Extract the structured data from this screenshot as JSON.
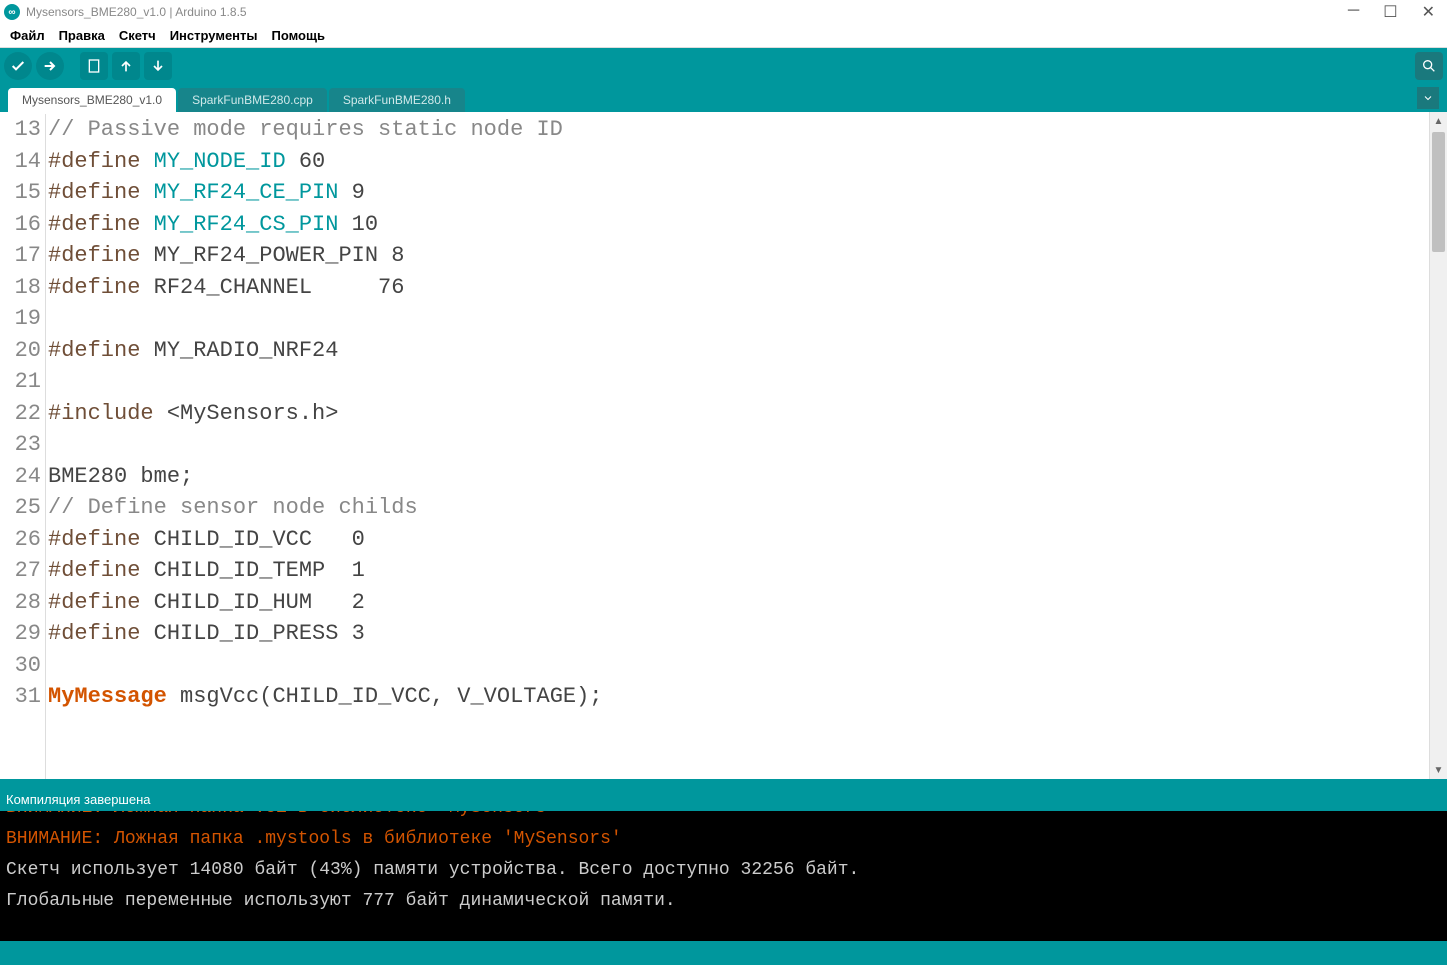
{
  "window": {
    "title": "Mysensors_BME280_v1.0 | Arduino 1.8.5"
  },
  "menu": {
    "file": "Файл",
    "edit": "Правка",
    "sketch": "Скетч",
    "tools": "Инструменты",
    "help": "Помощь"
  },
  "tabs": [
    {
      "label": "Mysensors_BME280_v1.0",
      "active": true
    },
    {
      "label": "SparkFunBME280.cpp",
      "active": false
    },
    {
      "label": "SparkFunBME280.h",
      "active": false
    }
  ],
  "editor": {
    "first_line": 13,
    "lines": [
      {
        "n": 13,
        "segs": [
          {
            "t": "// Passive mode requires static node ID",
            "c": "c-comment"
          }
        ]
      },
      {
        "n": 14,
        "segs": [
          {
            "t": "#define",
            "c": "c-preproc"
          },
          {
            "t": " ",
            "c": ""
          },
          {
            "t": "MY_NODE_ID",
            "c": "c-keyword"
          },
          {
            "t": " 60",
            "c": "c-text"
          }
        ]
      },
      {
        "n": 15,
        "segs": [
          {
            "t": "#define",
            "c": "c-preproc"
          },
          {
            "t": " ",
            "c": ""
          },
          {
            "t": "MY_RF24_CE_PIN",
            "c": "c-keyword"
          },
          {
            "t": " 9",
            "c": "c-text"
          }
        ]
      },
      {
        "n": 16,
        "segs": [
          {
            "t": "#define",
            "c": "c-preproc"
          },
          {
            "t": " ",
            "c": ""
          },
          {
            "t": "MY_RF24_CS_PIN",
            "c": "c-keyword"
          },
          {
            "t": " 10",
            "c": "c-text"
          }
        ]
      },
      {
        "n": 17,
        "segs": [
          {
            "t": "#define",
            "c": "c-preproc"
          },
          {
            "t": " MY_RF24_POWER_PIN 8",
            "c": "c-text"
          }
        ]
      },
      {
        "n": 18,
        "segs": [
          {
            "t": "#define",
            "c": "c-preproc"
          },
          {
            "t": " RF24_CHANNEL     76",
            "c": "c-text"
          }
        ]
      },
      {
        "n": 19,
        "segs": []
      },
      {
        "n": 20,
        "segs": [
          {
            "t": "#define",
            "c": "c-preproc"
          },
          {
            "t": " MY_RADIO_NRF24",
            "c": "c-text"
          }
        ]
      },
      {
        "n": 21,
        "segs": []
      },
      {
        "n": 22,
        "segs": [
          {
            "t": "#include",
            "c": "c-preproc"
          },
          {
            "t": " <MySensors.h>",
            "c": "c-text"
          }
        ]
      },
      {
        "n": 23,
        "segs": []
      },
      {
        "n": 24,
        "segs": [
          {
            "t": "BME280 bme;",
            "c": "c-text"
          }
        ]
      },
      {
        "n": 25,
        "segs": [
          {
            "t": "// Define sensor node childs",
            "c": "c-comment"
          }
        ]
      },
      {
        "n": 26,
        "segs": [
          {
            "t": "#define",
            "c": "c-preproc"
          },
          {
            "t": " CHILD_ID_VCC   0",
            "c": "c-text"
          }
        ]
      },
      {
        "n": 27,
        "segs": [
          {
            "t": "#define",
            "c": "c-preproc"
          },
          {
            "t": " CHILD_ID_TEMP  1",
            "c": "c-text"
          }
        ]
      },
      {
        "n": 28,
        "segs": [
          {
            "t": "#define",
            "c": "c-preproc"
          },
          {
            "t": " CHILD_ID_HUM   2",
            "c": "c-text"
          }
        ]
      },
      {
        "n": 29,
        "segs": [
          {
            "t": "#define",
            "c": "c-preproc"
          },
          {
            "t": " CHILD_ID_PRESS 3",
            "c": "c-text"
          }
        ]
      },
      {
        "n": 30,
        "segs": []
      },
      {
        "n": 31,
        "segs": [
          {
            "t": "MyMessage",
            "c": "c-keyword2"
          },
          {
            "t": " msgVcc(CHILD_ID_VCC, V_VOLTAGE);",
            "c": "c-text"
          }
        ]
      }
    ]
  },
  "status": {
    "message": "Компиляция завершена"
  },
  "console": {
    "lines": [
      {
        "text": "ВНИМАНИЕ: Ложная папка .ci в библиотеке 'MySensors'",
        "cls": "console-warn",
        "cut": true
      },
      {
        "text": "ВНИМАНИЕ: Ложная папка .mystools в библиотеке 'MySensors'",
        "cls": "console-warn"
      },
      {
        "text": "Скетч использует 14080 байт (43%) памяти устройства. Всего доступно 32256 байт.",
        "cls": ""
      },
      {
        "text": "Глобальные переменные используют 777 байт динамической памяти.",
        "cls": ""
      }
    ]
  }
}
